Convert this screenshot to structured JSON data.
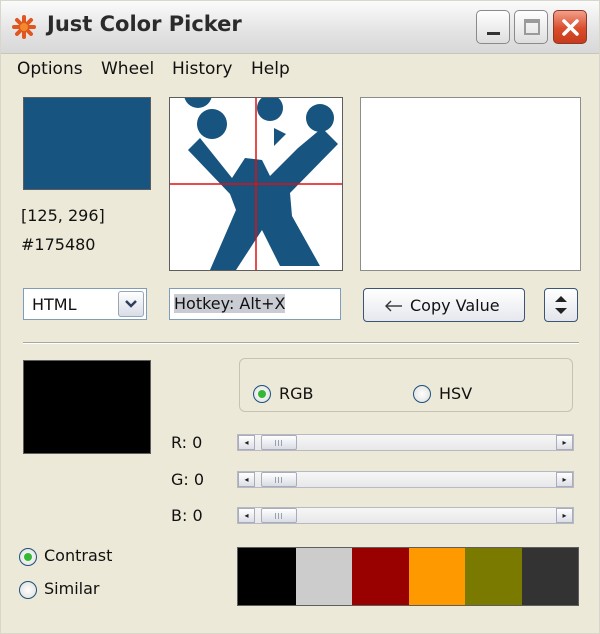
{
  "window": {
    "title": "Just Color Picker"
  },
  "menu": [
    "Options",
    "Wheel",
    "History",
    "Help"
  ],
  "picked": {
    "color": "#175480",
    "coords": "[125, 296]",
    "hex": "#175480"
  },
  "format": {
    "selected": "HTML"
  },
  "hotkey": {
    "text": "Hotkey: Alt+X"
  },
  "copy_button": {
    "label": "Copy Value"
  },
  "mode": {
    "options": [
      "RGB",
      "HSV"
    ],
    "selected": "RGB"
  },
  "sliders": [
    {
      "label": "R: 0",
      "value": 0
    },
    {
      "label": "G: 0",
      "value": 0
    },
    {
      "label": "B: 0",
      "value": 0
    }
  ],
  "scheme": {
    "options": [
      "Contrast",
      "Similar"
    ],
    "selected": "Contrast"
  },
  "palette": [
    "#000000",
    "#cccccc",
    "#990000",
    "#ff9900",
    "#7a7a00",
    "#333333"
  ],
  "colors": {
    "accent_blue": "#175480",
    "radio_green": "#35b935",
    "close_red": "#d94d2c"
  },
  "icons": {
    "app": "asterisk-picker-icon",
    "minimize": "minimize-icon",
    "maximize": "maximize-icon",
    "close": "close-icon",
    "dropdown": "chevron-down-icon",
    "copy": "arrow-left-icon",
    "spin": "up-down-icon"
  }
}
